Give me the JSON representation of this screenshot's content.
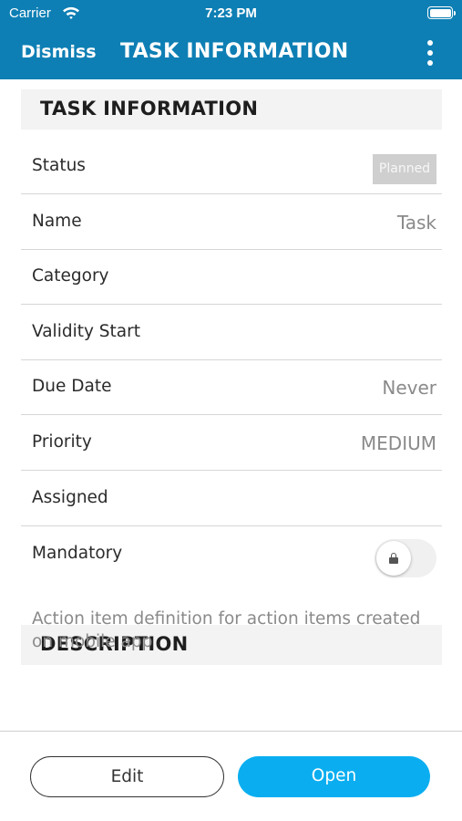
{
  "status_bar": {
    "carrier": "Carrier",
    "time": "7:23 PM"
  },
  "nav": {
    "dismiss_label": "Dismiss",
    "title": "TASK INFORMATION",
    "menu_icon": "kebab-menu-icon"
  },
  "task_section": {
    "header": "TASK INFORMATION",
    "rows": [
      {
        "label": "Status",
        "value": "Planned"
      },
      {
        "label": "Name",
        "value": "Task"
      },
      {
        "label": "Category",
        "value": ""
      },
      {
        "label": "Validity Start",
        "value": ""
      },
      {
        "label": "Due Date",
        "value": "Never"
      },
      {
        "label": "Priority",
        "value": "MEDIUM"
      },
      {
        "label": "Assigned",
        "value": ""
      },
      {
        "label": "Mandatory",
        "toggle": false,
        "locked": true
      }
    ]
  },
  "description_section": {
    "header": "DESCRIPTION",
    "text": "Action item definition for action items created on mobile app"
  },
  "footer": {
    "edit_label": "Edit",
    "open_label": "Open"
  },
  "colors": {
    "header_bg": "#0e7fb4",
    "accent": "#0aaef0",
    "status_badge_bg": "#cfcfcf"
  }
}
